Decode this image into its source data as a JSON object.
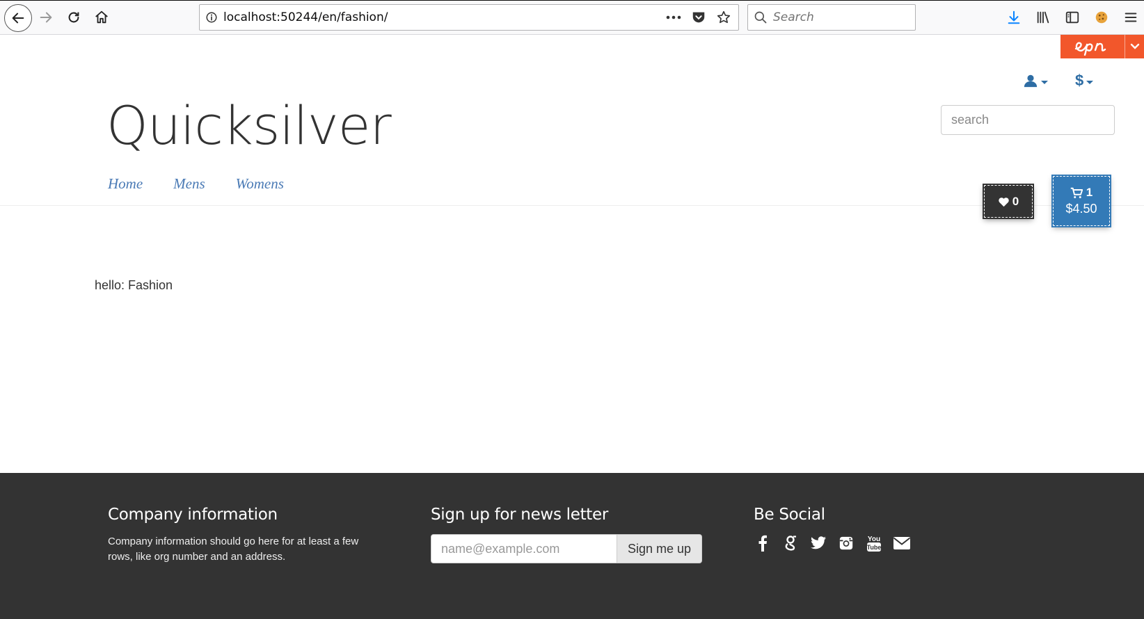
{
  "browser": {
    "url": "localhost:50244/en/fashion/",
    "search_placeholder": "Search"
  },
  "site": {
    "brand": "Quicksilver",
    "currency_symbol": "$",
    "search_placeholder": "search",
    "nav": [
      {
        "label": "Home"
      },
      {
        "label": "Mens"
      },
      {
        "label": "Womens"
      }
    ],
    "wishlist_count": "0",
    "cart_count": "1",
    "cart_total": "$4.50"
  },
  "main": {
    "hello_text": "hello: Fashion"
  },
  "footer": {
    "company_title": "Company information",
    "company_text": "Company information should go here for at least a few rows, like org number and an address.",
    "newsletter_title": "Sign up for news letter",
    "newsletter_placeholder": "name@example.com",
    "newsletter_button": "Sign me up",
    "social_title": "Be Social",
    "social_icons": [
      "facebook-icon",
      "google-icon",
      "twitter-icon",
      "instagram-icon",
      "youtube-icon",
      "email-icon"
    ]
  },
  "colors": {
    "brand_blue": "#337ab7",
    "episerver_orange": "#f2572b",
    "footer_bg": "#333333",
    "nav_link": "#4a7ab5"
  }
}
